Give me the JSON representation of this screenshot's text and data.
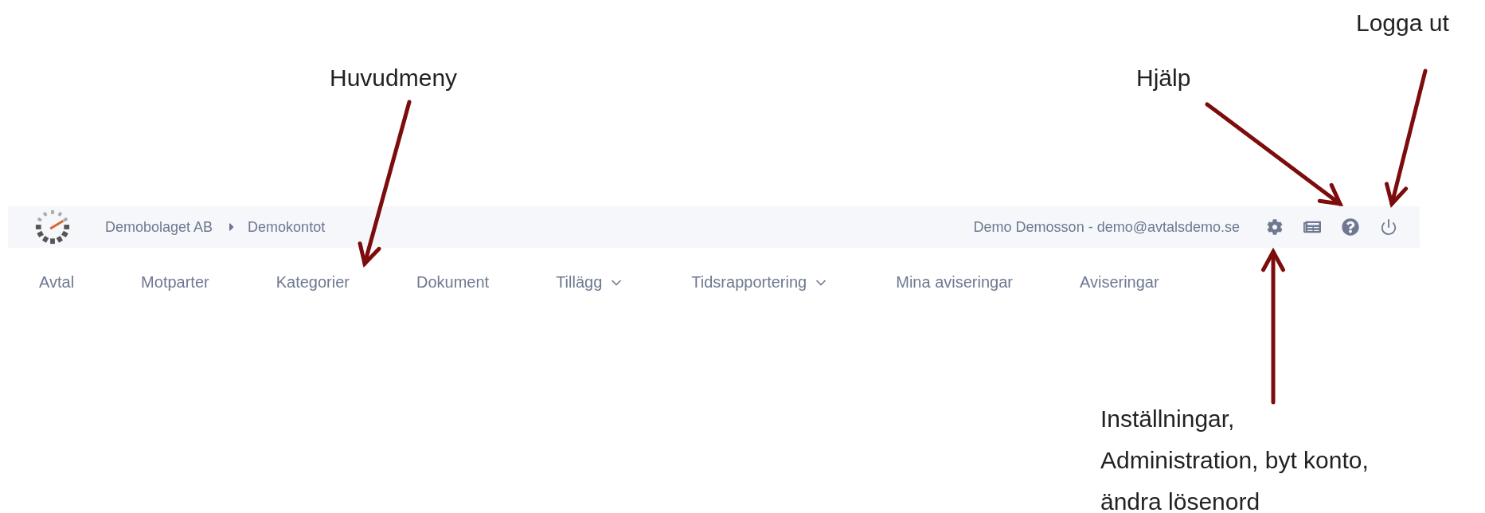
{
  "header": {
    "breadcrumb": [
      {
        "label": "Demobolaget AB"
      },
      {
        "label": "Demokontot"
      }
    ],
    "user": "Demo Demosson - demo@avtalsdemo.se"
  },
  "nav": [
    {
      "label": "Avtal",
      "dropdown": false
    },
    {
      "label": "Motparter",
      "dropdown": false
    },
    {
      "label": "Kategorier",
      "dropdown": false
    },
    {
      "label": "Dokument",
      "dropdown": false
    },
    {
      "label": "Tillägg",
      "dropdown": true
    },
    {
      "label": "Tidsrapportering",
      "dropdown": true
    },
    {
      "label": "Mina aviseringar",
      "dropdown": false
    },
    {
      "label": "Aviseringar",
      "dropdown": false
    }
  ],
  "annotations": [
    {
      "lines": [
        "Huvudmeny"
      ]
    },
    {
      "lines": [
        "Hjälp"
      ]
    },
    {
      "lines": [
        "Logga ut"
      ]
    },
    {
      "lines": [
        "Inställningar,",
        "Administration, byt konto,",
        "ändra lösenord"
      ]
    }
  ]
}
